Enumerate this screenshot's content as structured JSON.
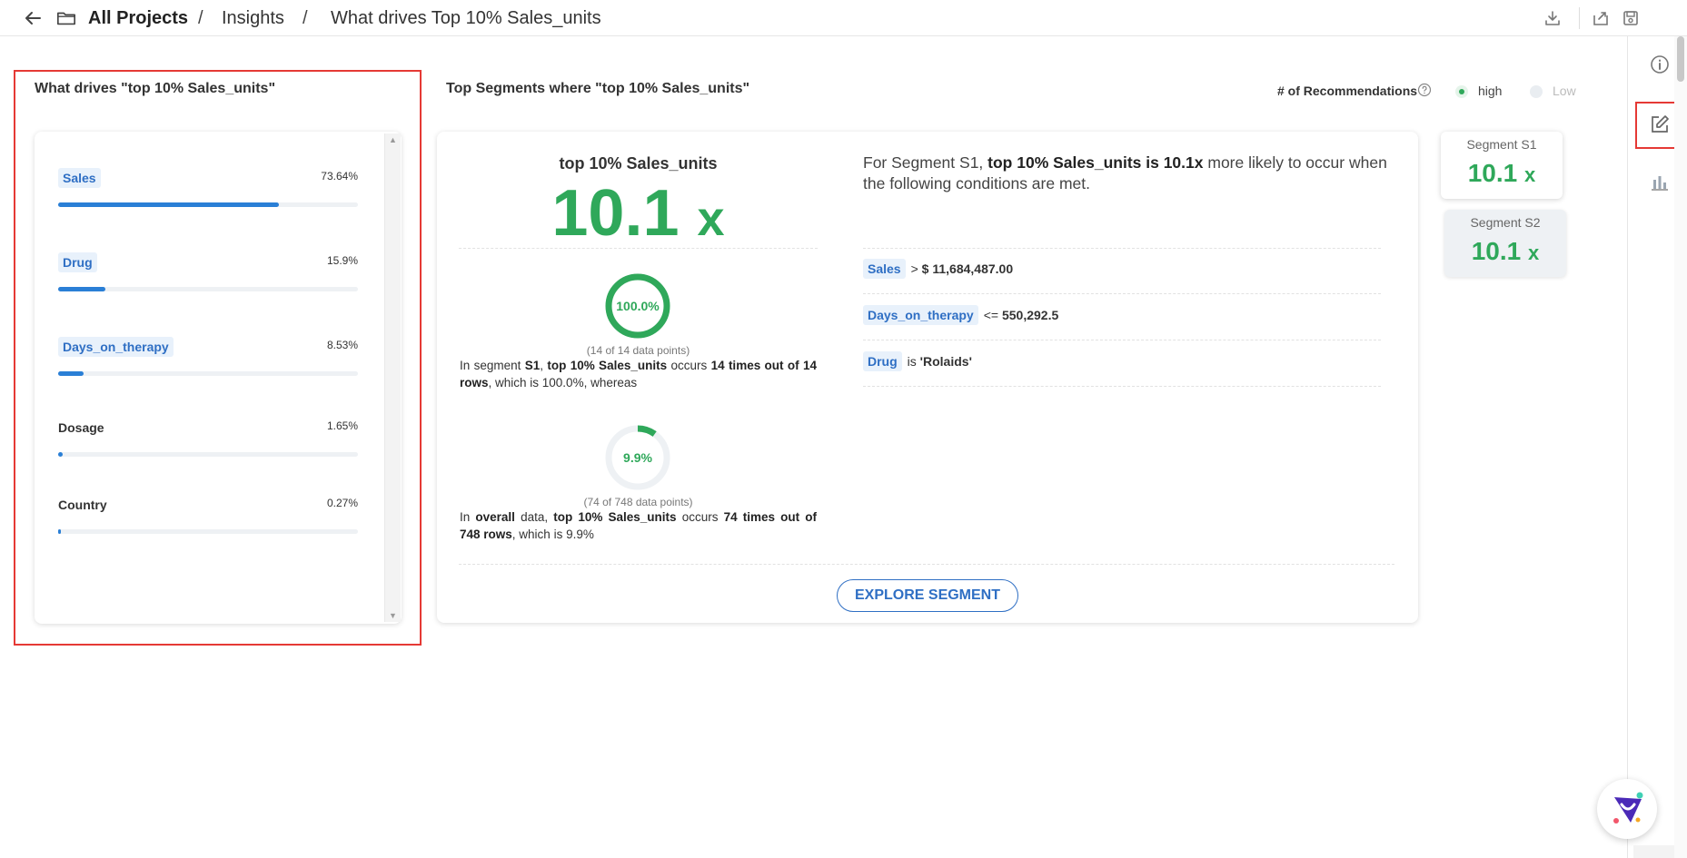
{
  "header": {
    "crumb_projects": "All Projects",
    "sep1": "/",
    "crumb_insights": "Insights",
    "sep2": "/",
    "crumb_current": "What drives Top 10% Sales_units"
  },
  "left_panel": {
    "title": "What drives \"top 10% Sales_units\"",
    "drivers": [
      {
        "label": "Sales",
        "pct_text": "73.64%",
        "share": 0.7364,
        "tagged": true
      },
      {
        "label": "Drug",
        "pct_text": "15.9%",
        "share": 0.159,
        "tagged": true
      },
      {
        "label": "Days_on_therapy",
        "pct_text": "8.53%",
        "share": 0.0853,
        "tagged": true
      },
      {
        "label": "Dosage",
        "pct_text": "1.65%",
        "share": 0.0165,
        "tagged": false
      },
      {
        "label": "Country",
        "pct_text": "0.27%",
        "share": 0.0027,
        "tagged": false
      }
    ]
  },
  "segments_header": {
    "title": "Top Segments where \"top 10% Sales_units\"",
    "rec_label": "# of Recommendations",
    "high_label": "high",
    "low_label": "Low",
    "selected": "high"
  },
  "segment": {
    "target": "top 10% Sales_units",
    "multiplier_value": "10.1",
    "multiplier_unit": "x",
    "seg_pct_text": "100.0%",
    "seg_fraction": 1.0,
    "seg_points": "(14 of 14 data points)",
    "seg_explain_html": "In segment <b>S1</b>, <b>top 10% Sales_units</b> occurs <b>14 times out of 14 rows</b>, which is 100.0%, whereas",
    "overall_pct_text": "9.9%",
    "overall_fraction": 0.099,
    "overall_points": "(74 of 748 data points)",
    "overall_explain_html": "In <b>overall</b> data, <b>top 10% Sales_units</b> occurs <b>74 times out of 748 rows</b>, which is 9.9%",
    "summary_html": "For Segment S1, <b>top 10% Sales_units is 10.1x</b> more likely to occur when the following conditions are met.",
    "conditions": [
      {
        "field": "Sales",
        "op": ">",
        "value": "$ 11,684,487.00"
      },
      {
        "field": "Days_on_therapy",
        "op": "<=",
        "value": "550,292.5"
      },
      {
        "field": "Drug",
        "op": "is",
        "value": "'Rolaids'"
      }
    ],
    "explore_label": "EXPLORE SEGMENT"
  },
  "segment_cards": [
    {
      "title": "Segment S1",
      "value": "10.1",
      "unit": "x"
    },
    {
      "title": "Segment S2",
      "value": "10.1",
      "unit": "x"
    }
  ],
  "colors": {
    "accent_green": "#2fa85a",
    "accent_blue": "#2a7fd6",
    "highlight_red": "#e53935"
  },
  "icons": {
    "back": "arrow-left-icon",
    "folder": "folder-icon",
    "download": "download-icon",
    "share": "share-icon",
    "save": "save-icon",
    "info": "info-icon",
    "edit": "edit-icon",
    "chart": "bar-chart-icon",
    "help": "help-circle-icon",
    "chat": "chat-assistant-icon"
  }
}
